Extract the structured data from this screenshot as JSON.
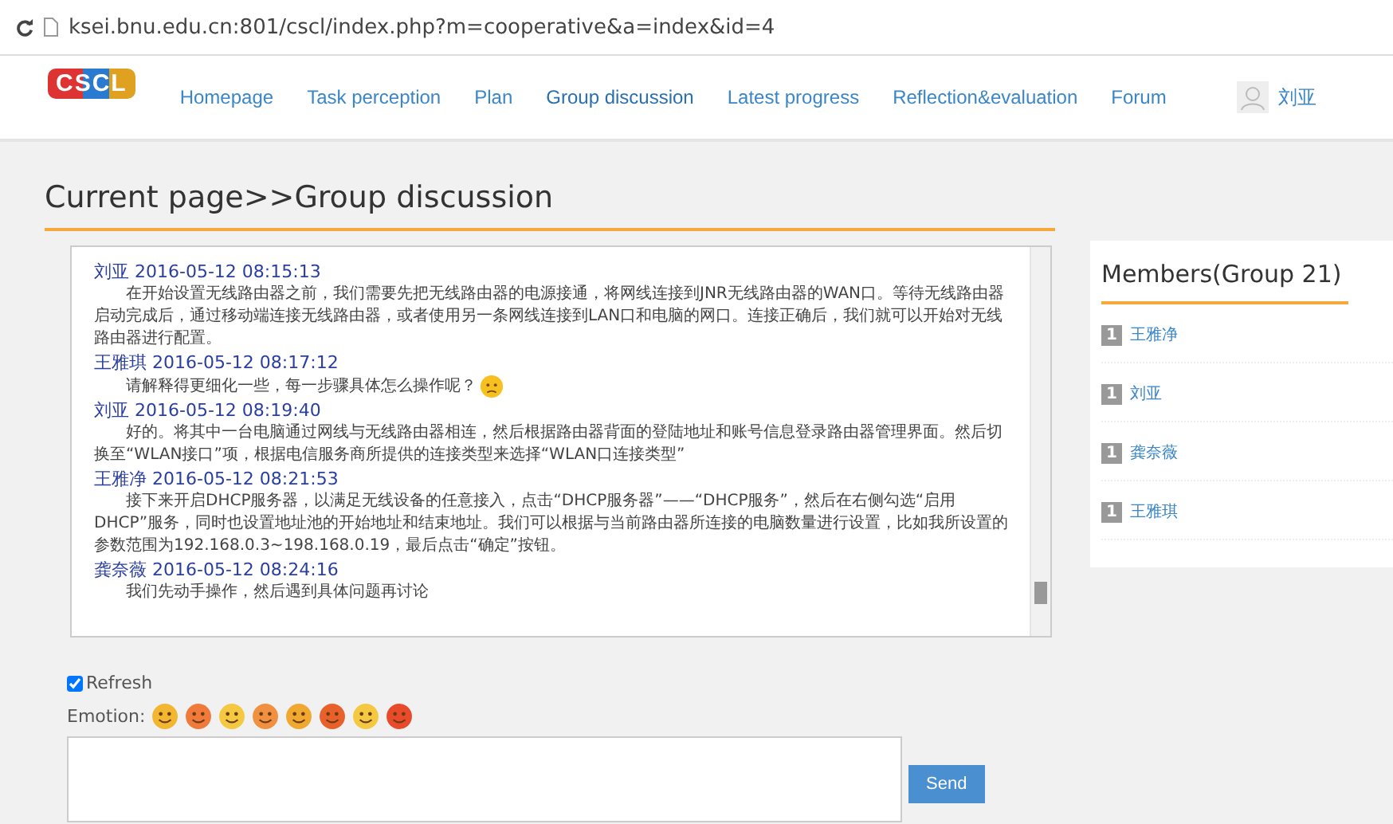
{
  "browser": {
    "url": "ksei.bnu.edu.cn:801/cscl/index.php?m=cooperative&a=index&id=4"
  },
  "nav": {
    "logo": "CSCL",
    "items": [
      {
        "label": "Homepage",
        "selected": false
      },
      {
        "label": "Task perception",
        "selected": false
      },
      {
        "label": "Plan",
        "selected": false
      },
      {
        "label": "Group discussion",
        "selected": true
      },
      {
        "label": "Latest progress",
        "selected": false
      },
      {
        "label": "Reflection&evaluation",
        "selected": false
      },
      {
        "label": "Forum",
        "selected": false
      }
    ],
    "user": "刘亚"
  },
  "page_title": "Current page>>Group discussion",
  "messages": [
    {
      "author": "刘亚",
      "time": "2016-05-12 08:15:13",
      "text": "在开始设置无线路由器之前，我们需要先把无线路由器的电源接通，将网线连接到JNR无线路由器的WAN口。等待无线路由器启动完成后，通过移动端连接无线路由器，或者使用另一条网线连接到LAN口和电脑的网口。连接正确后，我们就可以开始对无线路由器进行配置。",
      "emoji": false
    },
    {
      "author": "王雅琪",
      "time": "2016-05-12 08:17:12",
      "text": "请解释得更细化一些，每一步骤具体怎么操作呢？",
      "emoji": true
    },
    {
      "author": "刘亚",
      "time": "2016-05-12 08:19:40",
      "text": "好的。将其中一台电脑通过网线与无线路由器相连，然后根据路由器背面的登陆地址和账号信息登录路由器管理界面。然后切换至“WLAN接口”项，根据电信服务商所提供的连接类型来选择“WLAN口连接类型”",
      "emoji": false
    },
    {
      "author": "王雅净",
      "time": "2016-05-12 08:21:53",
      "text": "接下来开启DHCP服务器，以满足无线设备的任意接入，点击“DHCP服务器”——“DHCP服务”，然后在右侧勾选“启用DHCP”服务，同时也设置地址池的开始地址和结束地址。我们可以根据与当前路由器所连接的电脑数量进行设置，比如我所设置的参数范围为192.168.0.3~198.168.0.19，最后点击“确定”按钮。",
      "emoji": false
    },
    {
      "author": "龚奈薇",
      "time": "2016-05-12 08:24:16",
      "text": "我们先动手操作，然后遇到具体问题再讨论",
      "emoji": false
    }
  ],
  "refresh": {
    "label": "Refresh",
    "checked": true
  },
  "emotion_label": "Emotion:",
  "emotions": [
    {
      "color": "#f2b630"
    },
    {
      "color": "#f07a3a"
    },
    {
      "color": "#f5c842"
    },
    {
      "color": "#f09040"
    },
    {
      "color": "#f0a830"
    },
    {
      "color": "#e8602a"
    },
    {
      "color": "#f5c842"
    },
    {
      "color": "#e84a2a"
    }
  ],
  "send_button": "Send",
  "members": {
    "title": "Members(Group 21)",
    "items": [
      {
        "rank": "1",
        "name": "王雅净"
      },
      {
        "rank": "1",
        "name": "刘亚"
      },
      {
        "rank": "1",
        "name": "龚奈薇"
      },
      {
        "rank": "1",
        "name": "王雅琪"
      }
    ]
  }
}
